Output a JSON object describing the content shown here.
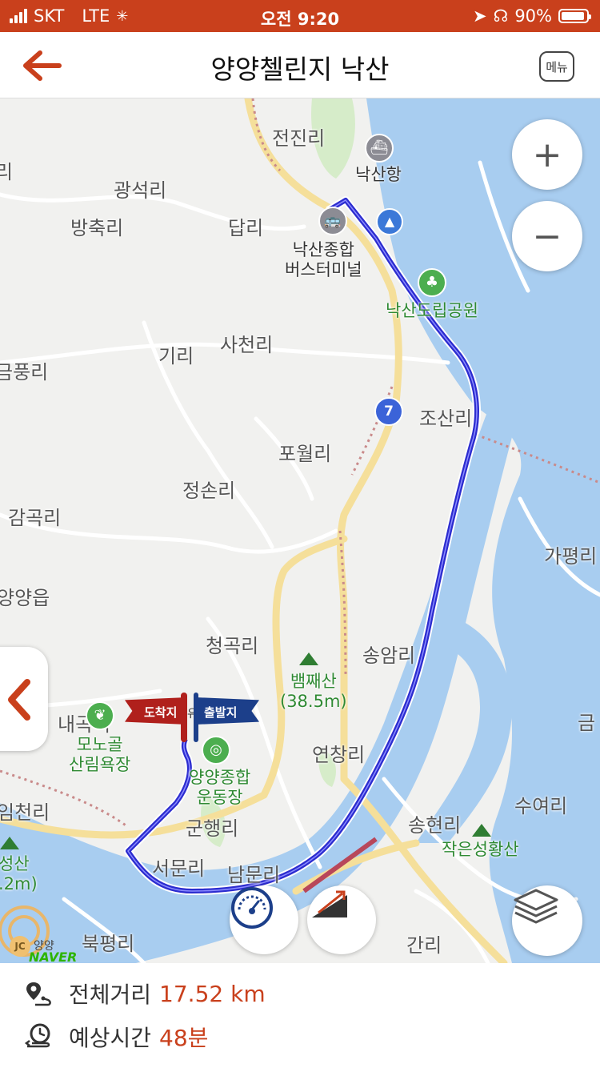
{
  "status_bar": {
    "carrier": "SKT",
    "network": "LTE",
    "time": "오전 9:20",
    "battery_text": "90%"
  },
  "nav": {
    "title": "양양첼린지 낙산",
    "menu_label": "메뉴"
  },
  "map": {
    "place_labels": [
      "전진리",
      "광석리",
      "방축리",
      "답리",
      "사천리",
      "기리",
      "금풍리",
      "조산리",
      "포월리",
      "정손리",
      "감곡리",
      "가평리",
      "양양읍",
      "청곡리",
      "송암리",
      "연창리",
      "내곡리",
      "금",
      "임천리",
      "군행리",
      "서문리",
      "남문리",
      "송현리",
      "수여리",
      "북평리",
      "간리",
      "리"
    ],
    "poi": {
      "port": "낙산항",
      "bus_terminal_line1": "낙산종합",
      "bus_terminal_line2": "버스터미널",
      "park": "낙산도립공원",
      "mountain_line1": "뱀째산",
      "mountain_line2": "(38.5m)",
      "forest_bath_line1": "모노골",
      "forest_bath_line2": "산림욕장",
      "stadium_line1": "양양종합",
      "stadium_line2": "운동장",
      "small_mountain": "작은성황산",
      "partial_mountain_line1": "성산",
      "partial_mountain_line2": ".2m)",
      "jc": "JC",
      "jc_name": "양양"
    },
    "road_number": "7",
    "flags": {
      "arrival": "도착지",
      "departure": "출발지",
      "middle": "유"
    },
    "naver_logo": "NAVER",
    "zoom_in": "+",
    "zoom_out": "−",
    "colors": {
      "route": "#2c2ccf",
      "water": "#a8cdf0",
      "accent": "#c9401c"
    }
  },
  "info": {
    "distance_label": "전체거리",
    "distance_value": "17.52 km",
    "time_label": "예상시간",
    "time_value": "48분"
  }
}
